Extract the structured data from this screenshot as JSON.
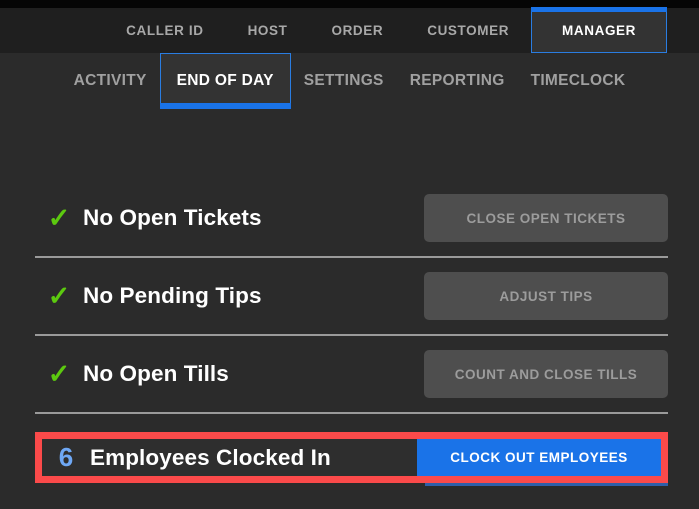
{
  "primary_nav": {
    "items": [
      {
        "label": "CALLER ID",
        "active": false
      },
      {
        "label": "HOST",
        "active": false
      },
      {
        "label": "ORDER",
        "active": false
      },
      {
        "label": "CUSTOMER",
        "active": false
      },
      {
        "label": "MANAGER",
        "active": true
      }
    ]
  },
  "secondary_nav": {
    "items": [
      {
        "label": "ACTIVITY",
        "active": false
      },
      {
        "label": "END OF DAY",
        "active": true
      },
      {
        "label": "SETTINGS",
        "active": false
      },
      {
        "label": "REPORTING",
        "active": false
      },
      {
        "label": "TIMECLOCK",
        "active": false
      }
    ]
  },
  "checklist": {
    "rows": [
      {
        "status_icon": "check-icon",
        "check_glyph": "✓",
        "count": "",
        "label": "No Open Tickets",
        "button_label": "CLOSE OPEN TICKETS",
        "button_state": "disabled"
      },
      {
        "status_icon": "check-icon",
        "check_glyph": "✓",
        "count": "",
        "label": "No Pending Tips",
        "button_label": "ADJUST TIPS",
        "button_state": "disabled"
      },
      {
        "status_icon": "check-icon",
        "check_glyph": "✓",
        "count": "",
        "label": "No Open Tills",
        "button_label": "COUNT AND CLOSE TILLS",
        "button_state": "disabled"
      }
    ],
    "highlighted_row": {
      "count": "6",
      "label": "Employees Clocked In",
      "button_label": "CLOCK OUT EMPLOYEES",
      "button_state": "enabled",
      "highlight": true
    }
  },
  "colors": {
    "background": "#2b2b2b",
    "top_strip": "#050505",
    "nav_bar": "#1f1f1f",
    "active_tab_bg": "#333333",
    "accent_blue": "#1a73e8",
    "tab_border_blue": "#2a7de1",
    "check_green": "#5cc90f",
    "count_blue": "#6fa8f5",
    "disabled_button": "#4e4e4e",
    "disabled_button_text": "#9c9c9c",
    "highlight_red": "#fb4a4a",
    "divider": "#9a9a9a",
    "inactive_nav_text": "#a8a8a8"
  }
}
